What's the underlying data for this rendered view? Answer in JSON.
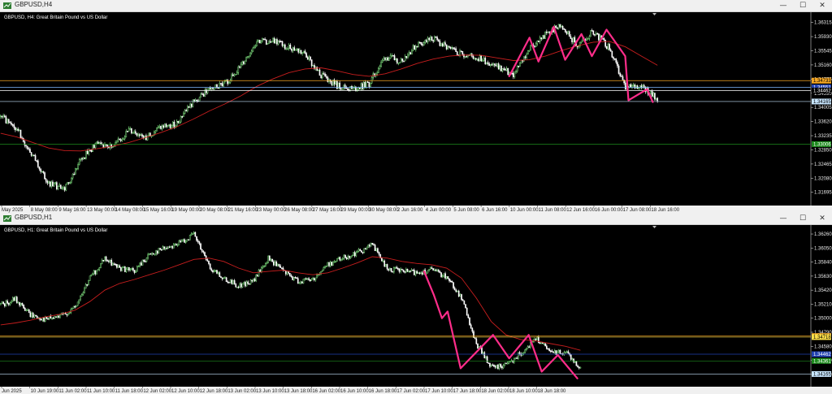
{
  "window_controls": {
    "minimize": "—",
    "maximize": "☐",
    "close": "✕"
  },
  "charts": [
    {
      "window_title": "GBPUSD,H4",
      "header": "GBPUSD, H4:  Great Britain Pound vs US Dollar",
      "price_ticks": [
        "1.36315",
        "1.35930",
        "1.35545",
        "1.35160",
        "1.34775",
        "1.34390",
        "1.34005",
        "1.33620",
        "1.33235",
        "1.32850",
        "1.32465",
        "1.32080",
        "1.31695"
      ],
      "price_range": [
        1.3138,
        1.3655
      ],
      "time_labels": [
        "May 2025",
        "8 May 08:00",
        "9 May 16:00",
        "13 May 00:00",
        "14 May 08:00",
        "15 May 16:00",
        "19 May 00:00",
        "20 May 08:00",
        "21 May 16:00",
        "23 May 00:00",
        "26 May 08:00",
        "27 May 16:00",
        "29 May 00:00",
        "30 May 08:00",
        "2 Jun 16:00",
        "4 Jun 00:00",
        "5 Jun 08:00",
        "6 Jun 16:00",
        "10 Jun 00:00",
        "11 Jun 08:00",
        "12 Jun 16:00",
        "16 Jun 00:00",
        "17 Jun 08:00",
        "18 Jun 16:00"
      ],
      "levels": [
        {
          "label": "1.34733",
          "value": 1.34733,
          "line": "#f5a623",
          "tag_bg": "#f5a623",
          "tag_text": "#000000"
        },
        {
          "label": "1.34551",
          "value": 1.34551,
          "line": "#7fb8ff",
          "tag_bg": "#1f3fb0",
          "tag_text": "#ffffff"
        },
        {
          "label": "1.34462",
          "value": 1.34462,
          "line": "#ffffff",
          "tag_bg": "#000000",
          "tag_text": "#ffffff"
        },
        {
          "label": "1.34165",
          "value": 1.34165,
          "line": "#c8e6ff",
          "tag_bg": "#c8e6ff",
          "tag_text": "#000000"
        },
        {
          "label": "1.33006",
          "value": 1.33006,
          "line": "#1c8a1c",
          "tag_bg": "#1c8a1c",
          "tag_text": "#ffffff"
        }
      ]
    },
    {
      "window_title": "GBPUSD,H1",
      "header": "GBPUSD, H1:  Great Britain Pound vs US Dollar",
      "price_ticks": [
        "1.36260",
        "1.36050",
        "1.35840",
        "1.35630",
        "1.35420",
        "1.35210",
        "1.35000",
        "1.34790",
        "1.34580",
        "1.34370",
        "1.34160"
      ],
      "price_range": [
        1.34,
        1.3637
      ],
      "time_labels": [
        "Jun 2025",
        "10 Jun 19:00",
        "11 Jun 02:00",
        "11 Jun 10:00",
        "11 Jun 18:00",
        "12 Jun 02:00",
        "12 Jun 10:00",
        "12 Jun 18:00",
        "13 Jun 02:00",
        "13 Jun 10:00",
        "13 Jun 18:00",
        "16 Jun 02:00",
        "16 Jun 10:00",
        "16 Jun 18:00",
        "17 Jun 02:00",
        "17 Jun 10:00",
        "17 Jun 18:00",
        "18 Jun 02:00",
        "18 Jun 10:00",
        "18 Jun 18:00"
      ],
      "levels": [
        {
          "label": "1.34733",
          "value": 1.34733,
          "line": "#f5a623",
          "tag_bg": "#f5a623",
          "tag_text": "#000000"
        },
        {
          "label": "1.34718",
          "value": 1.34718,
          "line": "#ffe14a",
          "tag_bg": "#ffe14a",
          "tag_text": "#000000"
        },
        {
          "label": "1.34462",
          "value": 1.34462,
          "line": "#1f3fb0",
          "tag_bg": "#1f3fb0",
          "tag_text": "#ffffff"
        },
        {
          "label": "1.34361",
          "value": 1.34361,
          "line": "#1c8a1c",
          "tag_bg": "#1c8a1c",
          "tag_text": "#ffffff"
        },
        {
          "label": "1.34165",
          "value": 1.34165,
          "line": "#c8e6ff",
          "tag_bg": "#c8e6ff",
          "tag_text": "#000000"
        }
      ]
    }
  ],
  "chart_data": [
    {
      "type": "candlestick",
      "symbol": "GBPUSD",
      "timeframe": "H4",
      "ylim": [
        1.3138,
        1.3655
      ],
      "series": [
        {
          "kind": "close_path",
          "values": [
            1.3375,
            1.3345,
            1.3268,
            1.3195,
            1.3178,
            1.3258,
            1.3302,
            1.3295,
            1.3338,
            1.3318,
            1.3343,
            1.3357,
            1.3415,
            1.3452,
            1.3465,
            1.351,
            1.3578,
            1.358,
            1.3562,
            1.3545,
            1.349,
            1.346,
            1.345,
            1.3465,
            1.3538,
            1.3528,
            1.3572,
            1.3588,
            1.3558,
            1.3545,
            1.3532,
            1.3512,
            1.3488,
            1.356,
            1.3598,
            1.3625,
            1.3568,
            1.3608,
            1.356,
            1.3452,
            1.3462,
            1.342
          ]
        },
        {
          "kind": "moving_average",
          "color": "#c81e1e",
          "values": [
            1.333,
            1.332,
            1.3305,
            1.329,
            1.3283,
            1.3282,
            1.3288,
            1.3295,
            1.3305,
            1.3318,
            1.3332,
            1.3348,
            1.3368,
            1.339,
            1.341,
            1.3432,
            1.3458,
            1.3478,
            1.3495,
            1.3505,
            1.3508,
            1.35,
            1.349,
            1.3485,
            1.3492,
            1.3505,
            1.352,
            1.3532,
            1.354,
            1.3543,
            1.3542,
            1.3535,
            1.3528,
            1.353,
            1.354,
            1.3555,
            1.3568,
            1.3578,
            1.358,
            1.3565,
            1.354,
            1.3515
          ]
        }
      ],
      "annotation": {
        "kind": "hand_drawn_zigzag",
        "color": "#ff2d8a",
        "points": [
          [
            0.628,
            1.3485
          ],
          [
            0.653,
            1.359
          ],
          [
            0.664,
            1.3525
          ],
          [
            0.683,
            1.362
          ],
          [
            0.697,
            1.353
          ],
          [
            0.717,
            1.36
          ],
          [
            0.73,
            1.354
          ],
          [
            0.748,
            1.3612
          ],
          [
            0.771,
            1.354
          ],
          [
            0.775,
            1.342
          ],
          [
            0.798,
            1.345
          ],
          [
            0.805,
            1.3415
          ]
        ]
      }
    },
    {
      "type": "candlestick",
      "symbol": "GBPUSD",
      "timeframe": "H1",
      "ylim": [
        1.34,
        1.3637
      ],
      "series": [
        {
          "kind": "close_path",
          "values": [
            1.352,
            1.3528,
            1.3505,
            1.3498,
            1.3502,
            1.3515,
            1.356,
            1.3588,
            1.3575,
            1.357,
            1.3595,
            1.3605,
            1.3612,
            1.3625,
            1.3578,
            1.356,
            1.3548,
            1.3555,
            1.359,
            1.357,
            1.3555,
            1.3558,
            1.358,
            1.359,
            1.3598,
            1.361,
            1.3575,
            1.357,
            1.3568,
            1.3572,
            1.3562,
            1.353,
            1.3462,
            1.3428,
            1.343,
            1.3448,
            1.347,
            1.3448,
            1.345,
            1.3425
          ]
        },
        {
          "kind": "moving_average",
          "color": "#c81e1e",
          "values": [
            1.349,
            1.3493,
            1.3497,
            1.3502,
            1.3506,
            1.3512,
            1.3525,
            1.3542,
            1.3552,
            1.3558,
            1.3565,
            1.3572,
            1.358,
            1.3588,
            1.359,
            1.3585,
            1.3575,
            1.3568,
            1.357,
            1.3572,
            1.3568,
            1.3565,
            1.3568,
            1.3575,
            1.3583,
            1.3592,
            1.359,
            1.3585,
            1.3582,
            1.358,
            1.3575,
            1.356,
            1.353,
            1.3495,
            1.3475,
            1.3468,
            1.3466,
            1.3462,
            1.3458,
            1.3452
          ]
        }
      ],
      "annotation": {
        "kind": "hand_drawn_zigzag",
        "color": "#ff2d8a",
        "points": [
          [
            0.523,
            1.357
          ],
          [
            0.535,
            1.3535
          ],
          [
            0.545,
            1.35
          ],
          [
            0.552,
            1.351
          ],
          [
            0.568,
            1.3425
          ],
          [
            0.608,
            1.3475
          ],
          [
            0.628,
            1.344
          ],
          [
            0.652,
            1.3475
          ],
          [
            0.668,
            1.342
          ],
          [
            0.688,
            1.3445
          ],
          [
            0.712,
            1.341
          ]
        ]
      }
    }
  ]
}
